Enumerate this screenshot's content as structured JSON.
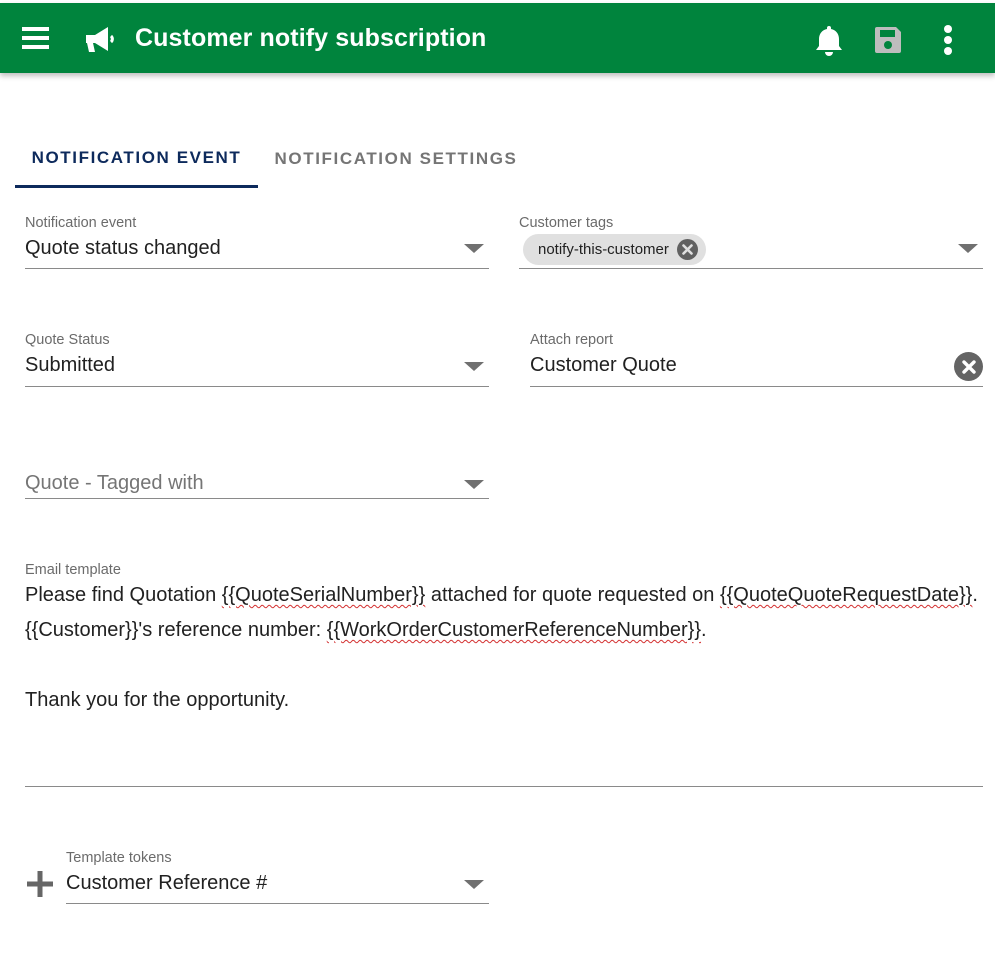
{
  "appbar": {
    "title": "Customer notify subscription",
    "background_color": "#00843d",
    "icons": {
      "menu": "hamburger-menu-icon",
      "page": "megaphone-icon",
      "notifications": "bell-icon",
      "save": "floppy-disk-icon",
      "more": "vertical-dots-icon"
    }
  },
  "tabs": [
    {
      "label": "NOTIFICATION EVENT",
      "active": true
    },
    {
      "label": "NOTIFICATION SETTINGS",
      "active": false
    }
  ],
  "form": {
    "notification_event": {
      "label": "Notification event",
      "value": "Quote status changed"
    },
    "customer_tags": {
      "label": "Customer tags",
      "chips": [
        "notify-this-customer"
      ]
    },
    "quote_status": {
      "label": "Quote Status",
      "value": "Submitted"
    },
    "attach_report": {
      "label": "Attach report",
      "value": "Customer Quote"
    },
    "quote_tagged_with": {
      "placeholder": "Quote - Tagged with"
    },
    "email_template": {
      "label": "Email template",
      "line1": {
        "t1": "Please find Quotation ",
        "tok1": "{{QuoteSerialNumber}}",
        "t2": " attached for quote requested on ",
        "tok2": "{{QuoteQuoteRequestDate}}",
        "t3": "."
      },
      "line2": {
        "t1": "{{Customer}}'s reference number: ",
        "tok1": "{{WorkOrderCustomerReferenceNumber}}",
        "t2": "."
      },
      "line3": "Thank you for the opportunity."
    },
    "template_tokens": {
      "label": "Template tokens",
      "value": "Customer Reference #"
    }
  }
}
